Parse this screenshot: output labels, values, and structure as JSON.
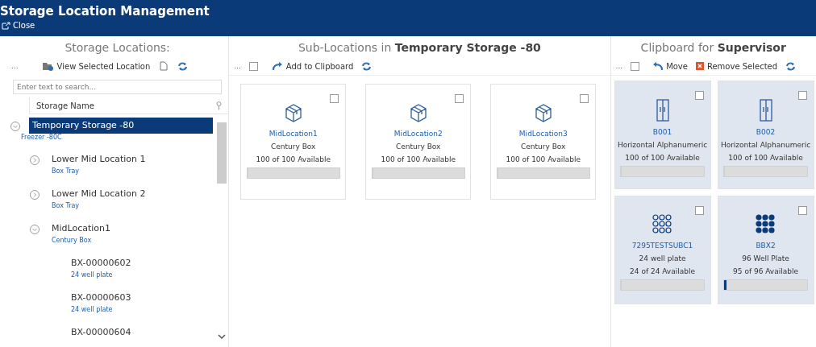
{
  "window": {
    "title": "Storage Location Management",
    "close": "Close"
  },
  "locations": {
    "title": "Storage Locations:",
    "more": "...",
    "view_button": "View Selected Location",
    "search": {
      "placeholder": "Enter text to search..."
    },
    "column": "Storage Name",
    "tree": [
      {
        "name": "Temporary Storage -80",
        "type": "Freezer -80C",
        "selected": true,
        "expanded": true,
        "children": [
          {
            "name": "Lower Mid Location 1",
            "type": "Box Tray",
            "selected": false,
            "expanded": false
          },
          {
            "name": "Lower Mid Location 2",
            "type": "Box Tray",
            "selected": false,
            "expanded": false
          },
          {
            "name": "MidLocation1",
            "type": "Century Box",
            "selected": false,
            "expanded": true,
            "children": [
              {
                "name": "BX-00000602",
                "type": "24 well plate",
                "selected": false
              },
              {
                "name": "BX-00000603",
                "type": "24 well plate",
                "selected": false
              },
              {
                "name": "BX-00000604",
                "selected": false
              }
            ]
          }
        ]
      }
    ]
  },
  "sublocations": {
    "title": "Sub-Locations in **Temporary Storage -80**",
    "more": "...",
    "select_all": false,
    "add_button": "Add to Clipboard",
    "cards": [
      {
        "kind": "box",
        "name": "MidLocation1",
        "type": "Century Box",
        "available": "100 of 100 Available",
        "checked": false,
        "level": 0
      },
      {
        "kind": "box",
        "name": "MidLocation2",
        "type": "Century Box",
        "available": "100 of 100 Available",
        "checked": false,
        "level": 0
      },
      {
        "kind": "box",
        "name": "MidLocation3",
        "type": "Century Box",
        "available": "100 of 100 Available",
        "checked": false,
        "level": 0
      }
    ]
  },
  "clipboard": {
    "title": "Clipboard for **Supervisor**",
    "more": "...",
    "select_all": false,
    "move_button": "Move",
    "remove_button": "Remove Selected",
    "cards": [
      {
        "kind": "rack",
        "name": "B001",
        "type": "Horizontal Alphanumeric",
        "available": "100 of 100 Available",
        "checked": false,
        "level": 0
      },
      {
        "kind": "rack",
        "name": "B002",
        "type": "Horizontal Alphanumeric",
        "available": "100 of 100 Available",
        "checked": false,
        "level": 0
      },
      {
        "kind": "plate-empty",
        "name": "7295TESTSUBC1",
        "type": "24 well plate",
        "available": "24 of 24 Available",
        "checked": false,
        "level": 0
      },
      {
        "kind": "plate-full",
        "name": "BBX2",
        "type": "96 Well Plate",
        "available": "95 of 96 Available",
        "checked": false,
        "level": 0.01
      }
    ]
  }
}
